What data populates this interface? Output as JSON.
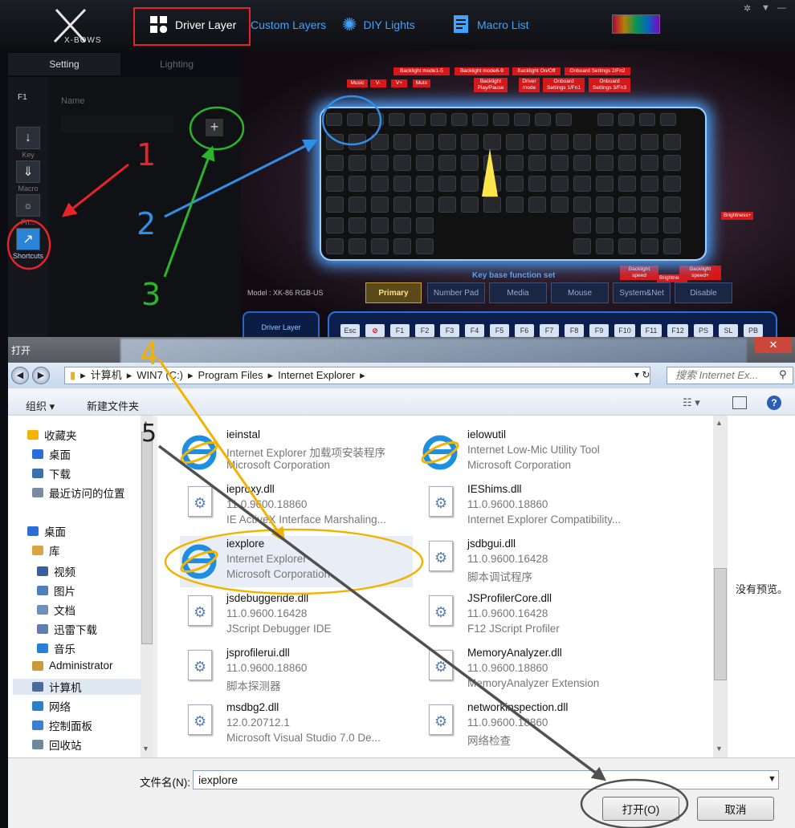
{
  "app": {
    "logo_text": "X-BOWS",
    "nav": [
      {
        "label": "Driver Layer"
      },
      {
        "label": "Custom Layers"
      },
      {
        "label": "DIY Lights"
      },
      {
        "label": "Macro List"
      }
    ],
    "subtabs": [
      "Setting",
      "Lighting"
    ],
    "layer_label": "F1",
    "name_label": "Name",
    "add_symbol": "+",
    "left_buttons": [
      {
        "label": "Key",
        "icon": "arrow-down-icon"
      },
      {
        "label": "Macro",
        "icon": "double-arrow-down-icon"
      },
      {
        "label": "Fn...",
        "icon": "lighting-icon"
      },
      {
        "label": "Shortcuts",
        "icon": "shortcut-icon"
      }
    ],
    "keyboard_labels": [
      "Backlight mode1-5",
      "Backlight mode6-9",
      "Backlight On/Off",
      "Onboard Settings 2/Fn2",
      "Music",
      "V-",
      "V+",
      "Mute",
      "Backlight Play/Pause",
      "Driver mode",
      "Onboard Settings 1/Fn1",
      "Onboard Settings 3/Fn3",
      "Brightness+",
      "Backlight speed",
      "Brightness-",
      "Backlight speed+"
    ],
    "key_base_title": "Key base function set",
    "model": "Model : XK-86 RGB-US",
    "function_tabs": [
      "Primary",
      "Number Pad",
      "Media",
      "Mouse",
      "System&Net",
      "Disable"
    ],
    "driver_layer_btn": "Driver Layer",
    "bottom_keys": [
      "Esc",
      "⊘",
      "F1",
      "F2",
      "F3",
      "F4",
      "F5",
      "F6",
      "F7",
      "F8",
      "F9",
      "F10",
      "F11",
      "F12",
      "PS",
      "SL",
      "PB"
    ]
  },
  "dialog": {
    "title": "打开",
    "close": "✕",
    "breadcrumb": [
      "计算机",
      "WIN7 (C:)",
      "Program Files",
      "Internet Explorer"
    ],
    "search_placeholder": "搜索 Internet Ex...",
    "organize": "组织 ▾",
    "new_folder": "新建文件夹",
    "nav_items": [
      {
        "label": "收藏夹",
        "color": "#f2b400"
      },
      {
        "label": "桌面",
        "color": "#2a6fd8"
      },
      {
        "label": "下载",
        "color": "#3a6fb0"
      },
      {
        "label": "最近访问的位置",
        "color": "#7a8aa0"
      },
      {
        "label": "桌面",
        "color": "#2a6fd8"
      },
      {
        "label": "库",
        "color": "#d9a441"
      },
      {
        "label": "视频",
        "color": "#3a5f9f"
      },
      {
        "label": "图片",
        "color": "#4f7fbf"
      },
      {
        "label": "文档",
        "color": "#6f8fbf"
      },
      {
        "label": "迅雷下载",
        "color": "#5f7fb0"
      },
      {
        "label": "音乐",
        "color": "#2a7fd8"
      },
      {
        "label": "Administrator",
        "color": "#c99a3a"
      },
      {
        "label": "计算机",
        "color": "#4a6a9a"
      },
      {
        "label": "网络",
        "color": "#2a7fc8"
      },
      {
        "label": "控制面板",
        "color": "#3a7fd0"
      },
      {
        "label": "回收站",
        "color": "#6a8aa0"
      }
    ],
    "files": [
      {
        "name": "ieinstal",
        "l2": "Internet Explorer 加载项安装程序",
        "l3": "Microsoft Corporation",
        "type": "ie"
      },
      {
        "name": "ielowutil",
        "l2": "Internet Low-Mic Utility Tool",
        "l3": "Microsoft Corporation",
        "type": "ie"
      },
      {
        "name": "ieproxy.dll",
        "l2": "11.0.9600.18860",
        "l3": "IE ActiveX Interface Marshaling...",
        "type": "dll"
      },
      {
        "name": "IEShims.dll",
        "l2": "11.0.9600.18860",
        "l3": "Internet Explorer Compatibility...",
        "type": "dll"
      },
      {
        "name": "iexplore",
        "l2": "Internet Explorer",
        "l3": "Microsoft Corporation",
        "type": "ie"
      },
      {
        "name": "jsdbgui.dll",
        "l2": "11.0.9600.16428",
        "l3": "脚本调试程序",
        "type": "dll"
      },
      {
        "name": "jsdebuggeride.dll",
        "l2": "11.0.9600.16428",
        "l3": "JScript Debugger IDE",
        "type": "dll"
      },
      {
        "name": "JSProfilerCore.dll",
        "l2": "11.0.9600.16428",
        "l3": "F12 JScript Profiler",
        "type": "dll"
      },
      {
        "name": "jsprofilerui.dll",
        "l2": "11.0.9600.18860",
        "l3": "脚本探测器",
        "type": "dll"
      },
      {
        "name": "MemoryAnalyzer.dll",
        "l2": "11.0.9600.18860",
        "l3": "MemoryAnalyzer Extension",
        "type": "dll"
      },
      {
        "name": "msdbg2.dll",
        "l2": "12.0.20712.1",
        "l3": "Microsoft Visual Studio 7.0 De...",
        "type": "dll"
      },
      {
        "name": "networkinspection.dll",
        "l2": "11.0.9600.18860",
        "l3": "网络检查",
        "type": "dll"
      }
    ],
    "preview_text": "没有预览。",
    "filename_label": "文件名(N):",
    "filename_value": "iexplore",
    "open_btn": "打开(O)",
    "cancel_btn": "取消"
  },
  "annotations": [
    "1",
    "2",
    "3",
    "4",
    "5"
  ],
  "colors": {
    "annotation_red": "#e8232a",
    "annotation_blue": "#2f8fe8",
    "annotation_green": "#2bb52b",
    "annotation_gold": "#f2b300",
    "annotation_gray": "#505050"
  }
}
